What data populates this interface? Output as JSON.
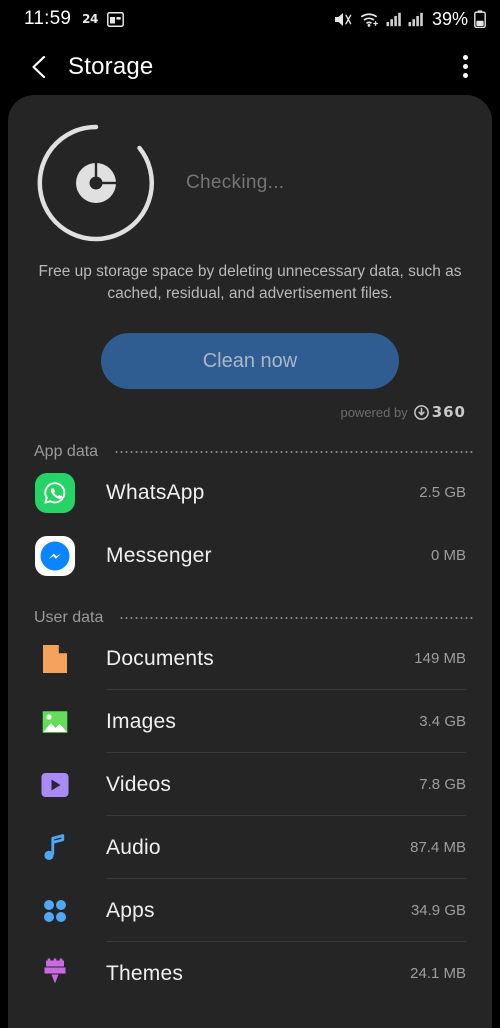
{
  "statusbar": {
    "time": "11:59",
    "icon_24_label": "24",
    "icons": [
      "alarm-24-icon",
      "multiwindow-icon",
      "mute-icon",
      "wifi-icon",
      "signal-sim1-icon",
      "signal-sim2-icon",
      "battery-icon"
    ],
    "battery_text": "39%"
  },
  "appbar": {
    "back_label": "back",
    "title": "Storage",
    "overflow_label": "more options"
  },
  "cleaner": {
    "status_text": "Checking...",
    "description": "Free up storage space by deleting unnecessary data, such as cached, residual, and advertisement files.",
    "clean_button": "Clean now",
    "powered_by": "powered by",
    "brand": "360",
    "button_color": "#2f5d91",
    "spinner_color": "#e0e0e0"
  },
  "sections": [
    {
      "label": "App data",
      "items": [
        {
          "name": "WhatsApp",
          "size": "2.5 GB",
          "icon": "whatsapp-icon",
          "color": "#25D366",
          "divider": false
        },
        {
          "name": "Messenger",
          "size": "0 MB",
          "icon": "messenger-icon",
          "color": "#0084FF",
          "divider": false
        }
      ]
    },
    {
      "label": "User data",
      "items": [
        {
          "name": "Documents",
          "size": "149 MB",
          "icon": "document-icon",
          "color": "#F5A25D",
          "divider": true
        },
        {
          "name": "Images",
          "size": "3.4 GB",
          "icon": "image-icon",
          "color": "#63DE5B",
          "divider": true
        },
        {
          "name": "Videos",
          "size": "7.8 GB",
          "icon": "video-icon",
          "color": "#A98BF5",
          "divider": true
        },
        {
          "name": "Audio",
          "size": "87.4 MB",
          "icon": "audio-note-icon",
          "color": "#4FA8F5",
          "divider": true
        },
        {
          "name": "Apps",
          "size": "34.9 GB",
          "icon": "apps-grid-icon",
          "color": "#4FA8F5",
          "divider": true
        },
        {
          "name": "Themes",
          "size": "24.1 MB",
          "icon": "themes-brush-icon",
          "color": "#C96BE0",
          "divider": false
        }
      ]
    }
  ]
}
